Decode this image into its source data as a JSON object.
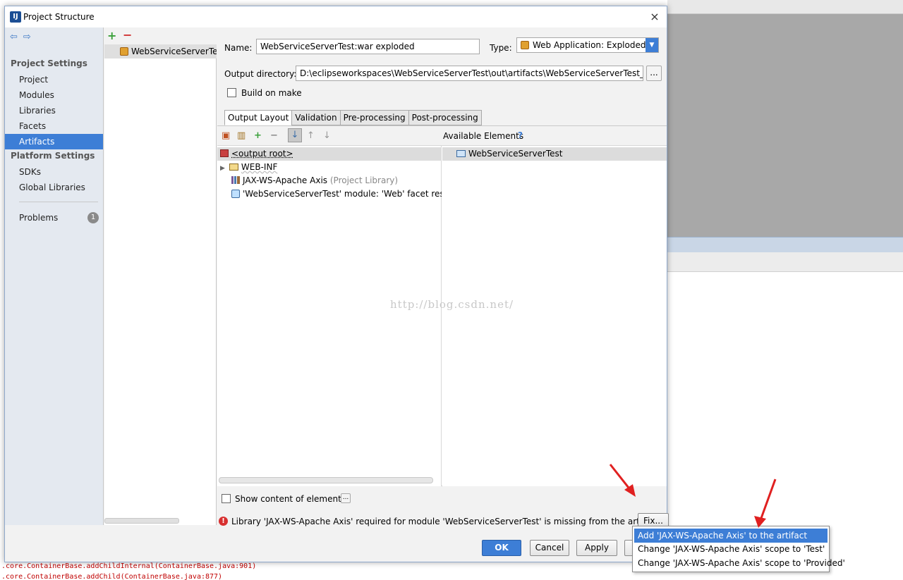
{
  "dialog": {
    "title": "Project Structure",
    "close_glyph": "×"
  },
  "sidebar": {
    "back_glyph": "⇦",
    "forward_glyph": "⇨",
    "project_settings_header": "Project Settings",
    "project_items": [
      "Project",
      "Modules",
      "Libraries",
      "Facets",
      "Artifacts"
    ],
    "platform_settings_header": "Platform Settings",
    "platform_items": [
      "SDKs",
      "Global Libraries"
    ],
    "problems_label": "Problems",
    "problems_count": "1"
  },
  "artifact_list": {
    "add_glyph": "+",
    "remove_glyph": "−",
    "items": [
      "WebServiceServerTest:"
    ]
  },
  "form": {
    "name_label": "Name:",
    "name_value": "WebServiceServerTest:war exploded",
    "type_label": "Type:",
    "type_value": "Web Application: Exploded",
    "output_dir_label": "Output directory:",
    "output_dir_value": "D:\\eclipseworkspaces\\WebServiceServerTest\\out\\artifacts\\WebServiceServerTest_war_expl",
    "browse_label": "...",
    "build_on_make_label": "Build on make"
  },
  "tabs": [
    "Output Layout",
    "Validation",
    "Pre-processing",
    "Post-processing"
  ],
  "layout": {
    "available_elements_label": "Available Elements",
    "help_glyph": "?",
    "tree": {
      "root": "<output root>",
      "web_inf": "WEB-INF",
      "library_name": "JAX-WS-Apache Axis",
      "library_suffix": "(Project Library)",
      "facet_resources": "'WebServiceServerTest' module: 'Web' facet resources"
    },
    "available_items": [
      "WebServiceServerTest"
    ],
    "watermark": "http://blog.csdn.net/"
  },
  "show_content_label": "Show content of elements",
  "show_content_btn": "...",
  "error": {
    "message": "Library 'JAX-WS-Apache Axis' required for module 'WebServiceServerTest' is missing from the artifact",
    "icon_glyph": "!",
    "fix_label": "Fix..."
  },
  "buttons": {
    "ok": "OK",
    "cancel": "Cancel",
    "apply": "Apply"
  },
  "fix_popup": {
    "items": [
      "Add 'JAX-WS-Apache Axis' to the artifact",
      "Change 'JAX-WS-Apache Axis' scope to 'Test'",
      "Change 'JAX-WS-Apache Axis' scope to 'Provided'"
    ]
  },
  "console": {
    "lines": [
      ".core.ContainerBase.addChildInternal(ContainerBase.java:901)",
      ".core.ContainerBase.addChild(ContainerBase.java:877)"
    ]
  },
  "colors": {
    "accent": "#3d7ed6",
    "error": "#d83030",
    "annotation_arrow": "#e02020"
  }
}
